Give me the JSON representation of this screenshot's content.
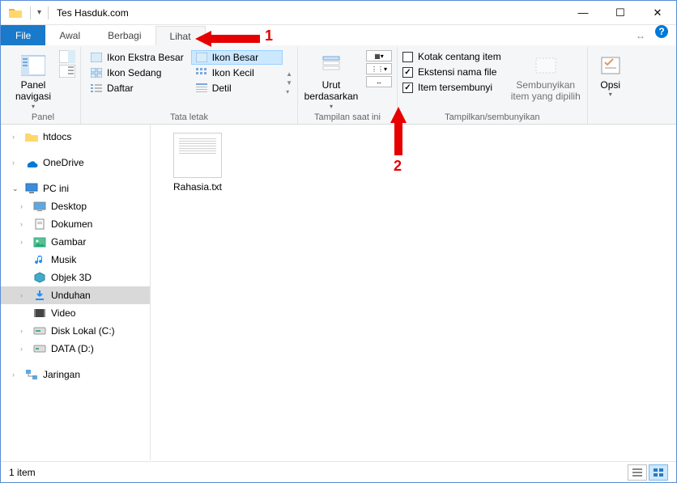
{
  "window": {
    "title": "Tes Hasduk.com"
  },
  "tabs": {
    "file": "File",
    "items": [
      "Awal",
      "Berbagi",
      "Lihat"
    ],
    "activeIndex": 2
  },
  "ribbon": {
    "panel": {
      "navPanel": "Panel\nnavigasi",
      "group": "Panel"
    },
    "layout": {
      "group": "Tata letak",
      "items": {
        "xlarge": "Ikon Ekstra Besar",
        "large": "Ikon Besar",
        "medium": "Ikon Sedang",
        "small": "Ikon Kecil",
        "list": "Daftar",
        "detail": "Detil"
      }
    },
    "currentView": {
      "sort": "Urut\nberdasarkan",
      "group": "Tampilan saat ini"
    },
    "showHide": {
      "checkbox": "Kotak centang item",
      "ext": "Ekstensi nama file",
      "hidden": "Item tersembunyi",
      "hideSelected": "Sembunyikan\nitem yang dipilih",
      "group": "Tampilkan/sembunyikan"
    },
    "options": {
      "label": "Opsi",
      "group": ""
    }
  },
  "tree": {
    "htdocs": "htdocs",
    "onedrive": "OneDrive",
    "pc": "PC ini",
    "desktop": "Desktop",
    "documents": "Dokumen",
    "pictures": "Gambar",
    "music": "Musik",
    "objects3d": "Objek 3D",
    "downloads": "Unduhan",
    "video": "Video",
    "diskC": "Disk Lokal (C:)",
    "diskD": "DATA (D:)",
    "network": "Jaringan"
  },
  "file": {
    "name": "Rahasia.txt"
  },
  "status": {
    "count": "1 item"
  },
  "annotations": {
    "a1": "1",
    "a2": "2"
  }
}
